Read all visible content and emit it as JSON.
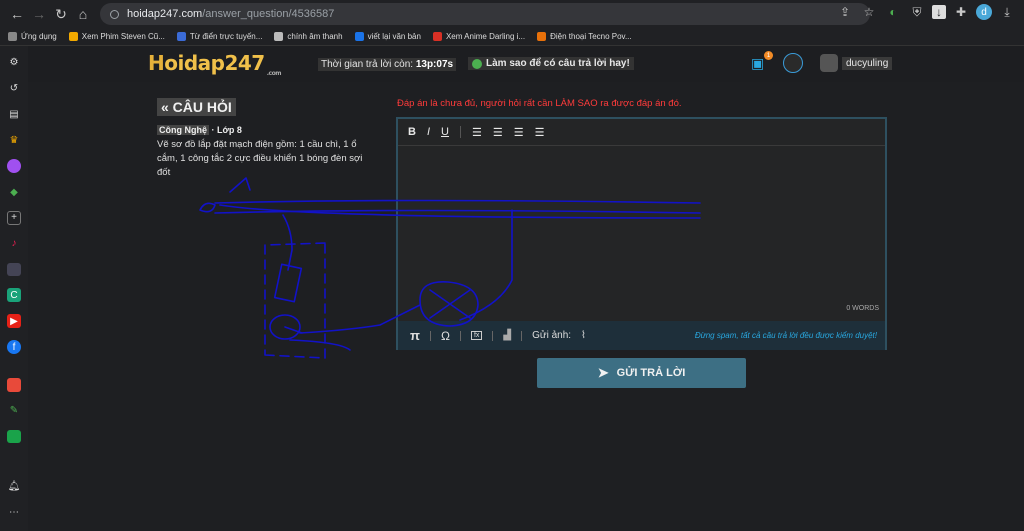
{
  "browser": {
    "url_host": "hoidap247.com",
    "url_path": "/answer_question/4536587",
    "profile_initial": "d"
  },
  "bookmarks": [
    {
      "label": "Ứng dụng",
      "color": "#888"
    },
    {
      "label": "Xem Phim Steven Cũ...",
      "color": "#f2a900"
    },
    {
      "label": "Từ điển trực tuyến...",
      "color": "#3b6bd6"
    },
    {
      "label": "chính âm thanh",
      "color": "#bbb"
    },
    {
      "label": "viết lại văn bản",
      "color": "#1a73e8"
    },
    {
      "label": "Xem Anime Darling i...",
      "color": "#d93025"
    },
    {
      "label": "Điện thoại Tecno Pov...",
      "color": "#e8710a"
    }
  ],
  "header": {
    "logo_prefix": "H",
    "logo_text": "oidap247",
    "logo_sub": ".com",
    "timer_label": "Thời gian trả lời còn:",
    "timer_value": "13p:07s",
    "howto": "Làm sao để có câu trả lời hay!",
    "chat_badge": "1",
    "username": "ducyuling"
  },
  "question": {
    "title": "« CÂU HỎI",
    "subject": "Công Nghệ",
    "sep": "·",
    "grade": "Lớp 8",
    "body": "Vẽ sơ đồ lắp đặt mạch điện gồm: 1 cầu chì, 1 ổ cắm, 1 công tắc 2 cực điều khiển 1 bóng đèn sợi đốt"
  },
  "answer": {
    "warning": "Đáp án là chưa đủ, người hỏi rất cần LÀM SAO ra được đáp án đó.",
    "toolbar": [
      "B",
      "I",
      "U"
    ],
    "word_count": "0 WORDS",
    "bottom_pi": "π",
    "bottom_omega": "Ω",
    "send_image": "Gửi ảnh:",
    "spam_note": "Đừng spam, tất cả câu trả lời đều được kiểm duyệt!",
    "submit_label": "GỬI TRẢ LỜI"
  },
  "colors": {
    "accent": "#3d6f84",
    "warning": "#ff3b3b",
    "link": "#29a8e0",
    "scribble": "#1010c8"
  }
}
